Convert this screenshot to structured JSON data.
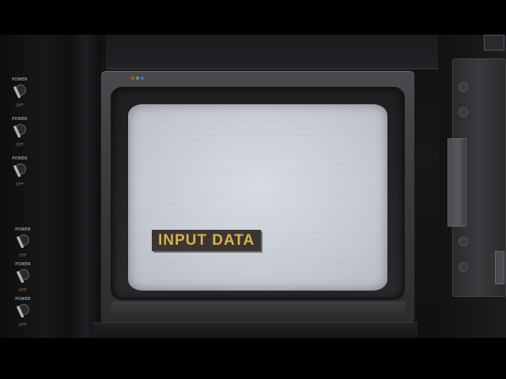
{
  "screen": {
    "label": "INPUT DATA"
  },
  "switches": [
    {
      "on_label": "POWER",
      "off_label": "OFF"
    },
    {
      "on_label": "POWER",
      "off_label": "OFF"
    },
    {
      "on_label": "POWER",
      "off_label": "OFF"
    },
    {
      "on_label": "POWER",
      "off_label": "OFF"
    },
    {
      "on_label": "POWER",
      "off_label": "OFF"
    },
    {
      "on_label": "POWER",
      "off_label": "OFF"
    }
  ],
  "colors": {
    "screen": "#cfd3da",
    "label_bg": "#3b3631",
    "label_text": "#d9b24c",
    "switch_off_text": "#b26a2a",
    "brand_dot_1": "#c94a3a",
    "brand_dot_2": "#4ab04a",
    "brand_dot_3": "#4a6ac9"
  },
  "icons": {
    "switch_lever": "toggle-switch-icon",
    "brand": "brand-color-dots-icon"
  }
}
